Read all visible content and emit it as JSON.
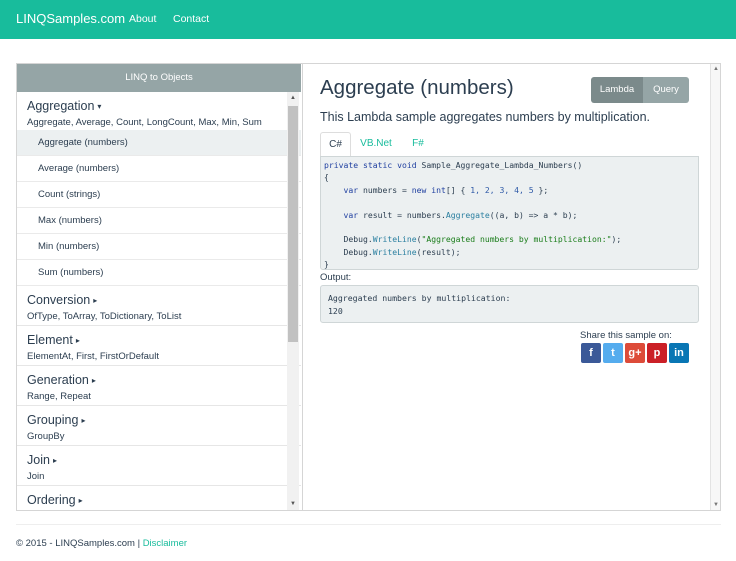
{
  "navbar": {
    "brand": "LINQSamples.com",
    "links": [
      "About",
      "Contact"
    ]
  },
  "sidebar": {
    "header": "LINQ to Objects",
    "groups": [
      {
        "title": "Aggregation",
        "caret": "▾",
        "subtitle": "Aggregate, Average, Count, LongCount, Max, Min, Sum",
        "items": [
          "Aggregate (numbers)",
          "Average (numbers)",
          "Count (strings)",
          "Max (numbers)",
          "Min (numbers)",
          "Sum (numbers)"
        ]
      },
      {
        "title": "Conversion",
        "caret": "▸",
        "subtitle": "OfType, ToArray, ToDictionary, ToList"
      },
      {
        "title": "Element",
        "caret": "▸",
        "subtitle": "ElementAt, First, FirstOrDefault"
      },
      {
        "title": "Generation",
        "caret": "▸",
        "subtitle": "Range, Repeat"
      },
      {
        "title": "Grouping",
        "caret": "▸",
        "subtitle": "GroupBy"
      },
      {
        "title": "Join",
        "caret": "▸",
        "subtitle": "Join"
      },
      {
        "title": "Ordering",
        "caret": "▸",
        "subtitle": ""
      }
    ]
  },
  "scroll_icons": {
    "up": "▲",
    "down": "▼"
  },
  "content": {
    "title": "Aggregate (numbers)",
    "toggle": {
      "lambda": "Lambda",
      "query": "Query"
    },
    "description": "This Lambda sample aggregates numbers by multiplication.",
    "tabs": [
      "C#",
      "VB.Net",
      "F#"
    ],
    "code_lines": [
      "private static void Sample_Aggregate_Lambda_Numbers()",
      "{",
      "    var numbers = new int[] { 1, 2, 3, 4, 5 };",
      "",
      "    var result = numbers.Aggregate((a, b) => a * b);",
      "",
      "    Debug.WriteLine(\"Aggregated numbers by multiplication:\");",
      "    Debug.WriteLine(result);",
      "}"
    ],
    "output_label": "Output:",
    "output_lines": [
      "Aggregated numbers by multiplication:",
      "120"
    ],
    "share_label": "Share this sample on:",
    "social": [
      {
        "name": "facebook",
        "glyph": "f",
        "color": "#3b5998"
      },
      {
        "name": "twitter",
        "glyph": "t",
        "color": "#55acee"
      },
      {
        "name": "google-plus",
        "glyph": "g+",
        "color": "#dd4b39"
      },
      {
        "name": "pinterest",
        "glyph": "p",
        "color": "#cb2027"
      },
      {
        "name": "linkedin",
        "glyph": "in",
        "color": "#0976b4"
      }
    ]
  },
  "footer": {
    "copyright": "© 2015 - LINQSamples.com",
    "separator": "|",
    "link": "Disclaimer"
  },
  "colors": {
    "accent": "#18bc9c",
    "dark": "#2c3e50"
  }
}
